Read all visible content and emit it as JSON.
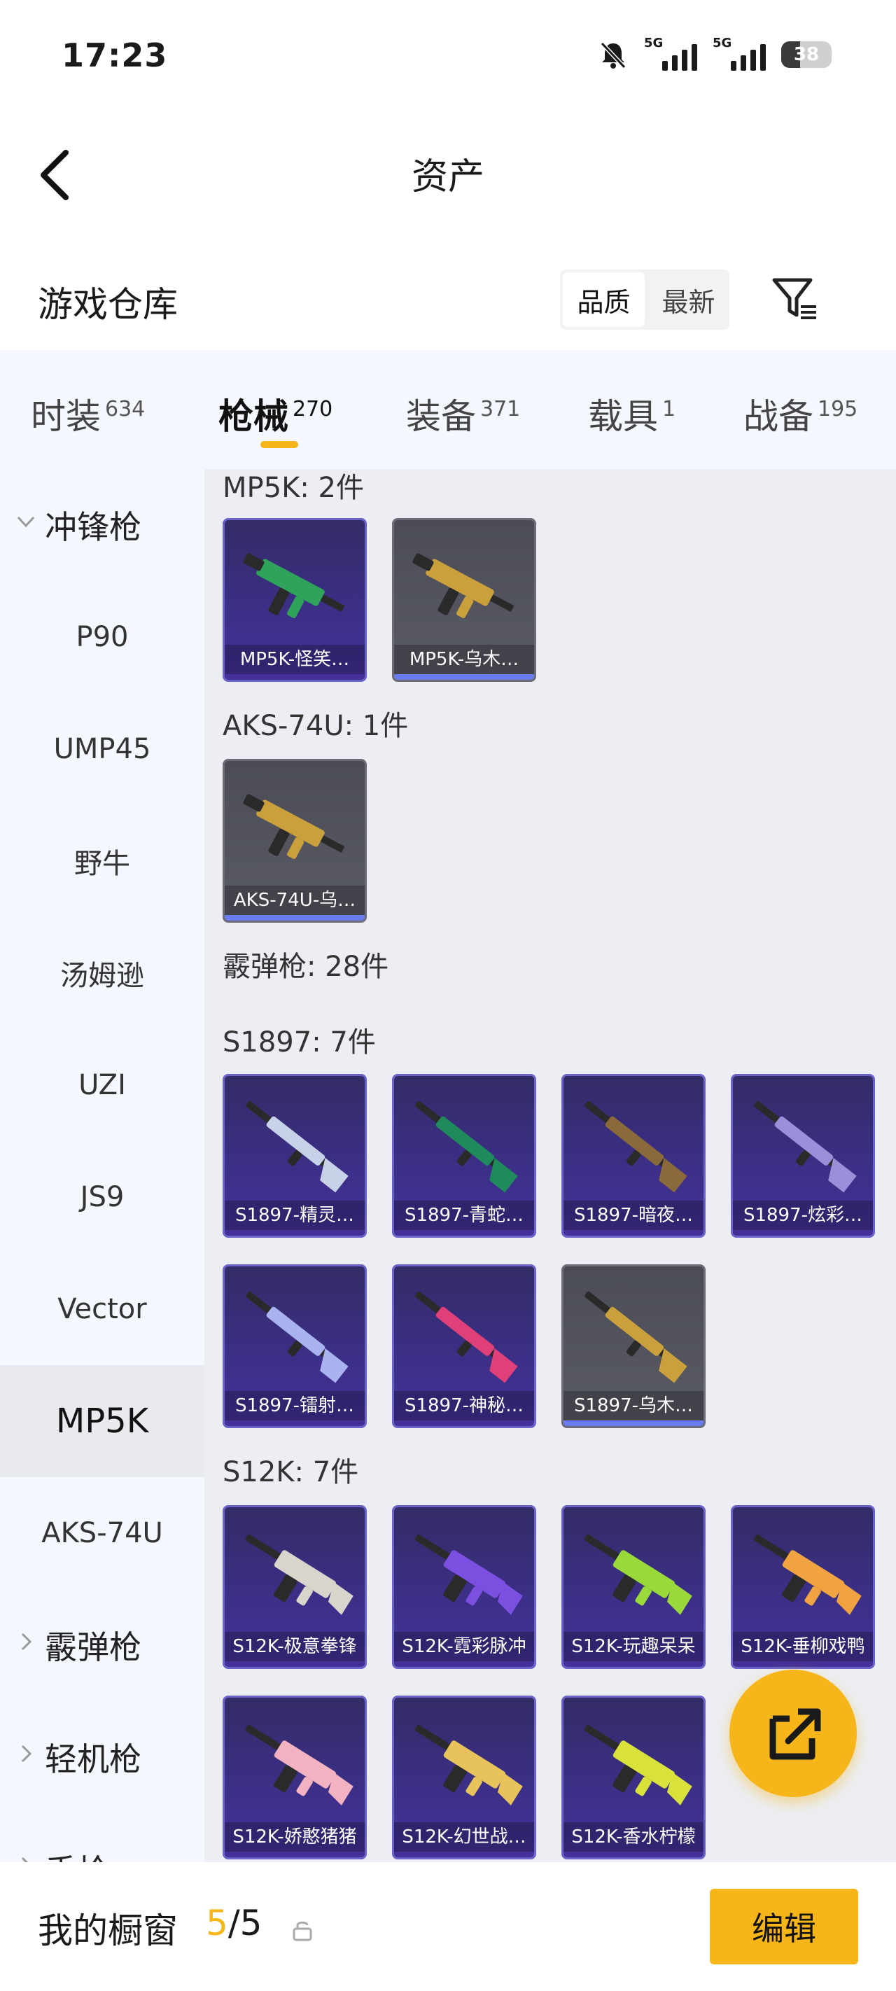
{
  "status": {
    "time": "17:23",
    "signal1_label": "5G",
    "signal2_label": "5G",
    "battery": "38",
    "icons": [
      "mute-bell-icon",
      "signal-icon",
      "signal-icon",
      "battery-icon"
    ]
  },
  "header": {
    "title": "资产"
  },
  "warehouse": {
    "title": "游戏仓库",
    "sort_quality": "品质",
    "sort_latest": "最新"
  },
  "tabs": [
    {
      "label": "时装",
      "count": "634"
    },
    {
      "label": "枪械",
      "count": "270"
    },
    {
      "label": "装备",
      "count": "371"
    },
    {
      "label": "载具",
      "count": "1"
    },
    {
      "label": "战备",
      "count": "195"
    }
  ],
  "sidebar": {
    "items": [
      {
        "label": "冲锋枪"
      },
      {
        "label": "P90"
      },
      {
        "label": "UMP45"
      },
      {
        "label": "野牛"
      },
      {
        "label": "汤姆逊"
      },
      {
        "label": "UZI"
      },
      {
        "label": "JS9"
      },
      {
        "label": "Vector"
      },
      {
        "label": "MP5K"
      },
      {
        "label": "AKS-74U"
      },
      {
        "label": "霰弹枪"
      },
      {
        "label": "轻机枪"
      },
      {
        "label": "手枪"
      }
    ]
  },
  "content": {
    "sections": [
      {
        "title": "MP5K: 2件"
      },
      {
        "title": "AKS-74U: 1件"
      },
      {
        "title": "霰弹枪: 28件"
      },
      {
        "title": "S1897: 7件"
      },
      {
        "title": "S12K: 7件"
      }
    ],
    "cards": [
      {
        "label": "MP5K-怪笑…",
        "color": "#2fa35a"
      },
      {
        "label": "MP5K-乌木…",
        "color": "#c9a03c"
      },
      {
        "label": "AKS-74U-乌…",
        "color": "#c9a03c"
      },
      {
        "label": "S1897-精灵…",
        "color": "#c7d2e8"
      },
      {
        "label": "S1897-青蛇…",
        "color": "#1f8a5b"
      },
      {
        "label": "S1897-暗夜…",
        "color": "#8a6a3a"
      },
      {
        "label": "S1897-炫彩…",
        "color": "#9a8fd8"
      },
      {
        "label": "S1897-镭射…",
        "color": "#a9b3ef"
      },
      {
        "label": "S1897-神秘…",
        "color": "#e0407a"
      },
      {
        "label": "S1897-乌木…",
        "color": "#c9a03c"
      },
      {
        "label": "S12K-极意拳锋",
        "color": "#d9d4cc"
      },
      {
        "label": "S12K-霓彩脉冲",
        "color": "#7b4fe0"
      },
      {
        "label": "S12K-玩趣呆呆",
        "color": "#9ad93a"
      },
      {
        "label": "S12K-垂柳戏鸭",
        "color": "#f0a340"
      },
      {
        "label": "S12K-娇憨猪猪",
        "color": "#f3b2c2"
      },
      {
        "label": "S12K-幻世战…",
        "color": "#e8c25a"
      },
      {
        "label": "S12K-香水柠檬",
        "color": "#d8e23a"
      }
    ]
  },
  "bottom": {
    "label": "我的橱窗",
    "count_used": "5",
    "count_sep": "/",
    "count_total": "5",
    "edit": "编辑"
  },
  "colors": {
    "accent": "#f6b619",
    "rare_border": "#6a63c9",
    "rare_bar": "#6a7df0"
  }
}
